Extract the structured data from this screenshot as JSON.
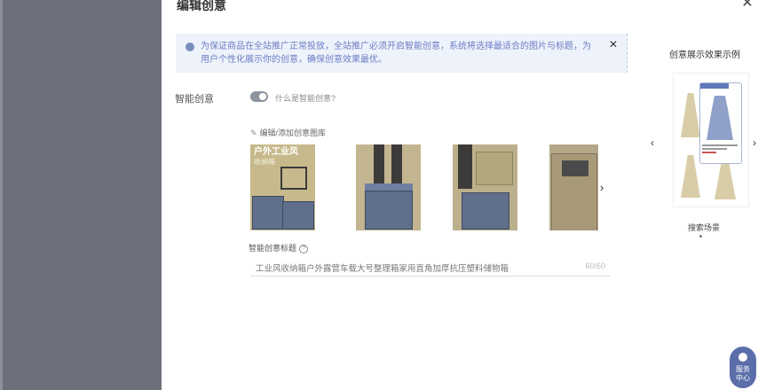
{
  "dialog": {
    "title": "编辑创意",
    "close_icon": "close-icon"
  },
  "notice": {
    "text": "为保证商品在全站推广正常投放，全站推广必须开启智能创意，系统将选择最适合的图片与标题，为用户个性化展示你的创意，确保创意效果最优。",
    "close_icon": "close-icon"
  },
  "smart_creative": {
    "label": "智能创意",
    "toggle_on": true,
    "help_link": "什么是智能创意?"
  },
  "gallery": {
    "edit_link": "编辑/添加创意图库",
    "edit_icon": "pencil-icon",
    "thumb1_caption": "户外工业风",
    "thumb1_sub": "收纳箱",
    "next_icon": "chevron-right-icon"
  },
  "smart_title": {
    "label": "智能创意标题",
    "value": "工业风收纳箱户外露营车载大号整理箱家用直角加厚抗压塑料储物箱",
    "count": "60/60"
  },
  "preview": {
    "title": "创意展示效果示例",
    "caption": "搜索场景",
    "prev_icon": "chevron-left-icon",
    "next_icon": "chevron-right-icon"
  },
  "service": {
    "label_line1": "服务",
    "label_line2": "中心"
  }
}
